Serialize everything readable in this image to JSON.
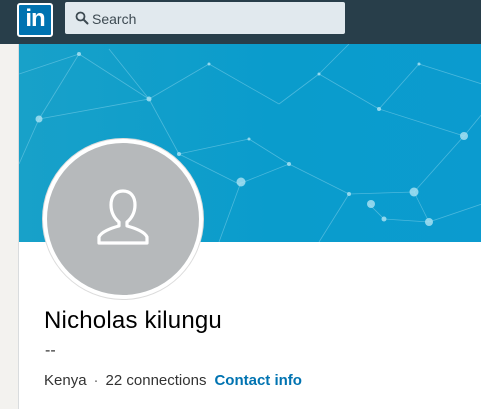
{
  "nav": {
    "logo_text": "in",
    "search_placeholder": "Search",
    "search_icon": "search-icon"
  },
  "profile": {
    "avatar_icon": "person-silhouette-icon",
    "name": "Nicholas kilungu",
    "headline": "--",
    "location": "Kenya",
    "separator": "·",
    "connections": "22 connections",
    "contact_info_label": "Contact info"
  },
  "colors": {
    "nav_bg": "#283e4a",
    "brand_blue": "#0073b1",
    "banner_blue": "#0b9ccd",
    "avatar_gray": "#b6b9bb",
    "link_blue": "#0073b1"
  }
}
